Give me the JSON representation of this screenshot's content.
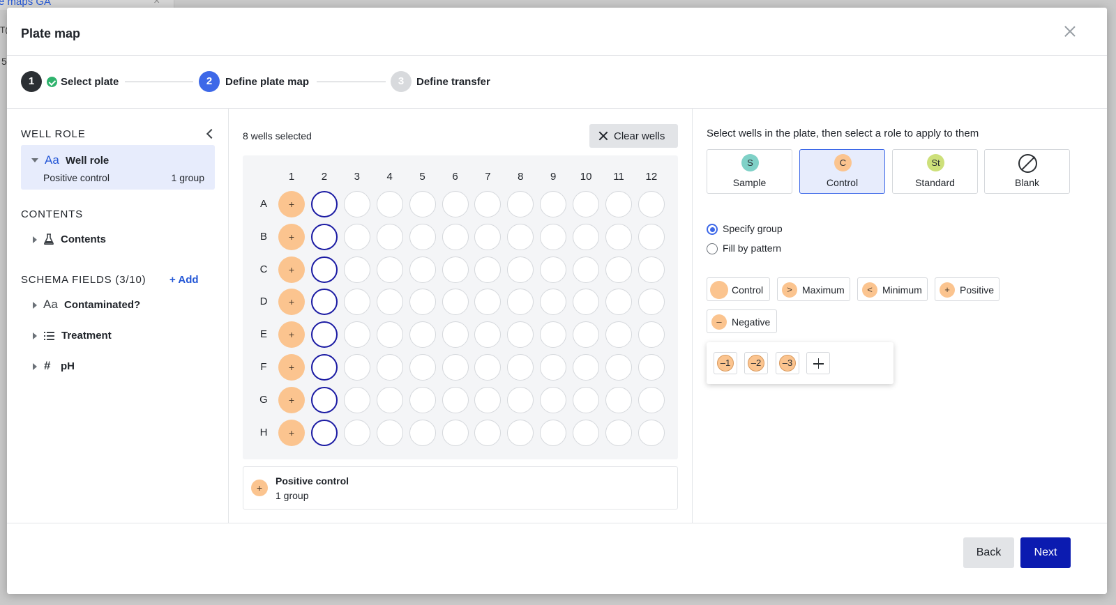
{
  "background": {
    "tab_label": "e maps GA",
    "tab_close": "×",
    "edge_text_a": "T(",
    "edge_text_b": "5"
  },
  "modal": {
    "title": "Plate map",
    "close_icon": "close-icon"
  },
  "stepper": {
    "steps": [
      {
        "number": "1",
        "label": "Select plate",
        "state": "done"
      },
      {
        "number": "2",
        "label": "Define plate map",
        "state": "active"
      },
      {
        "number": "3",
        "label": "Define transfer",
        "state": "future"
      }
    ]
  },
  "left_panel": {
    "well_role_heading": "WELL ROLE",
    "well_role_card": {
      "icon": "Aa",
      "title": "Well role",
      "subtitle": "Positive control",
      "count": "1 group"
    },
    "contents_heading": "CONTENTS",
    "contents_item": {
      "label": "Contents",
      "icon": "flask-icon"
    },
    "schema_heading": "SCHEMA FIELDS (3/10)",
    "add_label": "+ Add",
    "schema_fields": [
      {
        "label": "Contaminated?",
        "icon": "Aa"
      },
      {
        "label": "Treatment",
        "icon": "list-icon"
      },
      {
        "label": "pH",
        "icon": "#"
      }
    ]
  },
  "plate_panel": {
    "selection_text": "8 wells selected",
    "clear_label": "Clear wells",
    "columns": [
      "1",
      "2",
      "3",
      "4",
      "5",
      "6",
      "7",
      "8",
      "9",
      "10",
      "11",
      "12"
    ],
    "rows": [
      "A",
      "B",
      "C",
      "D",
      "E",
      "F",
      "G",
      "H"
    ],
    "control_column": "1",
    "selected_column": "2",
    "control_symbol": "+",
    "legend": {
      "symbol": "+",
      "title": "Positive control",
      "subtitle": "1 group"
    }
  },
  "right_panel": {
    "instruction": "Select wells in the plate, then select a role to apply to them",
    "roles": [
      {
        "badge": "S",
        "label": "Sample",
        "color": "#7fd1c7",
        "active": false
      },
      {
        "badge": "C",
        "label": "Control",
        "color": "#fbc48f",
        "active": true
      },
      {
        "badge": "St",
        "label": "Standard",
        "color": "#cde07a",
        "active": false
      },
      {
        "badge": "",
        "label": "Blank",
        "color": "#ffffff",
        "active": false
      }
    ],
    "radio_options": [
      {
        "label": "Specify group",
        "checked": true
      },
      {
        "label": "Fill by pattern",
        "checked": false
      }
    ],
    "groups": [
      {
        "symbol": "",
        "label": "Control"
      },
      {
        "symbol": ">",
        "label": "Maximum"
      },
      {
        "symbol": "<",
        "label": "Minimum"
      },
      {
        "symbol": "+",
        "label": "Positive"
      },
      {
        "symbol": "–",
        "label": "Negative"
      }
    ],
    "subgroups": [
      "–1",
      "–2",
      "–3"
    ]
  },
  "footer": {
    "back_label": "Back",
    "next_label": "Next"
  },
  "colors": {
    "control_orange": "#fbc48f",
    "selected_well_border": "#1a1aa3",
    "primary_blue": "#0b1bb0",
    "active_step_blue": "#3d68e8",
    "link_blue": "#2457d6",
    "check_green": "#2fb36d"
  }
}
